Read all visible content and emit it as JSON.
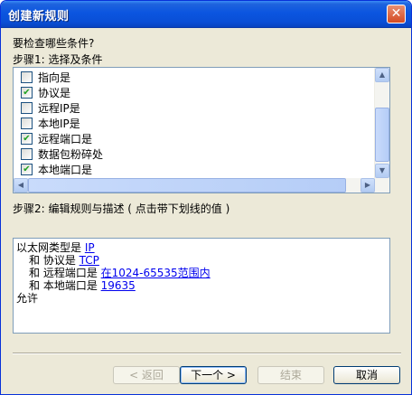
{
  "window": {
    "title": "创建新规则",
    "close_symbol": "✕"
  },
  "question": "要检查哪些条件?",
  "step1_label": "步骤1: 选择及条件",
  "conditions": [
    {
      "label": "指向是",
      "checked": false
    },
    {
      "label": "协议是",
      "checked": true
    },
    {
      "label": "远程IP是",
      "checked": false
    },
    {
      "label": "本地IP是",
      "checked": false
    },
    {
      "label": "远程端口是",
      "checked": true
    },
    {
      "label": "数据包粉碎处",
      "checked": false
    },
    {
      "label": "本地端口是",
      "checked": true
    }
  ],
  "scroll_icons": {
    "up": "▲",
    "down": "▼",
    "left": "◀",
    "right": "▶"
  },
  "step2_label": "步骤2: 编辑规则与描述 ( 点击带下划线的值 )",
  "description": {
    "line1_prefix": "以太网类型是 ",
    "line1_link": "IP",
    "line2_prefix": "和 协议是 ",
    "line2_link": "TCP",
    "line3_prefix": "和 远程端口是 ",
    "line3_link": "在1024-65535范围内",
    "line4_prefix": "和 本地端口是 ",
    "line4_link": "19635",
    "line5": "允许"
  },
  "buttons": {
    "back": "< 返回",
    "next": "下一个 >",
    "finish": "结束",
    "cancel": "取消"
  },
  "checkmark": "✔"
}
